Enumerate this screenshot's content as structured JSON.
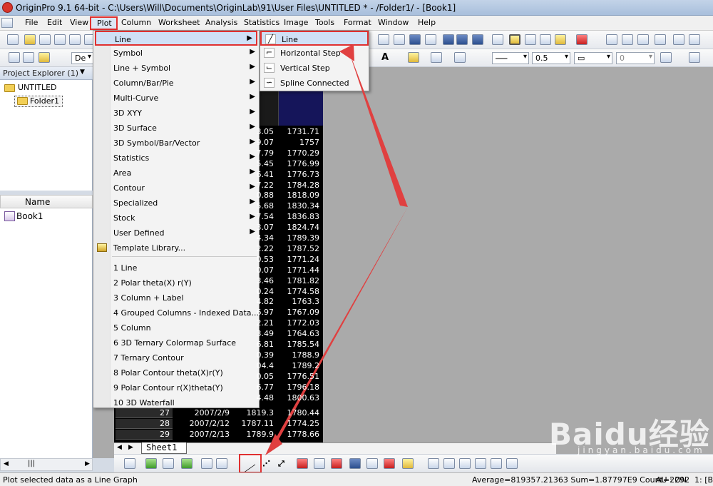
{
  "window": {
    "title": "OriginPro 9.1 64-bit - C:\\Users\\Will\\Documents\\OriginLab\\91\\User Files\\UNTITLED * - /Folder1/ - [Book1]"
  },
  "menubar": {
    "file": "File",
    "edit": "Edit",
    "view": "View",
    "plot": "Plot",
    "column": "Column",
    "worksheet": "Worksheet",
    "analysis": "Analysis",
    "statistics": "Statistics",
    "image": "Image",
    "tools": "Tools",
    "format": "Format",
    "window": "Window",
    "help": "Help"
  },
  "format_toolbar": {
    "line_width": "0.5",
    "value_zero": "0",
    "font_abbrev": "De"
  },
  "project_explorer": {
    "title": "Project Explorer (1)",
    "root": "UNTITLED",
    "folder": "Folder1",
    "list_header": "Name",
    "items": [
      "Book1"
    ]
  },
  "plot_menu": [
    {
      "label": "Line",
      "submenu": true
    },
    {
      "label": "Symbol",
      "submenu": true
    },
    {
      "label": "Line + Symbol",
      "submenu": true
    },
    {
      "label": "Column/Bar/Pie",
      "submenu": true
    },
    {
      "label": "Multi-Curve",
      "submenu": true
    },
    {
      "label": "3D XYY",
      "submenu": true
    },
    {
      "label": "3D Surface",
      "submenu": true
    },
    {
      "label": "3D Symbol/Bar/Vector",
      "submenu": true
    },
    {
      "label": "Statistics",
      "submenu": true
    },
    {
      "label": "Area",
      "submenu": true
    },
    {
      "label": "Contour",
      "submenu": true
    },
    {
      "label": "Specialized",
      "submenu": true
    },
    {
      "label": "Stock",
      "submenu": true
    },
    {
      "label": "User Defined",
      "submenu": true
    },
    {
      "label": "Template Library...",
      "submenu": false
    },
    {
      "label": "1 Line",
      "submenu": false
    },
    {
      "label": "2 Polar theta(X) r(Y)",
      "submenu": false
    },
    {
      "label": "3 Column + Label",
      "submenu": false
    },
    {
      "label": "4 Grouped Columns - Indexed Data...",
      "submenu": false
    },
    {
      "label": "5 Column",
      "submenu": false
    },
    {
      "label": "6 3D Ternary Colormap Surface",
      "submenu": false
    },
    {
      "label": "7 Ternary Contour",
      "submenu": false
    },
    {
      "label": "8 Polar Contour theta(X)r(Y)",
      "submenu": false
    },
    {
      "label": "9 Polar Contour r(X)theta(Y)",
      "submenu": false
    },
    {
      "label": "10 3D Waterfall",
      "submenu": false
    }
  ],
  "line_submenu": [
    "Line",
    "Horizontal Step",
    "Vertical Step",
    "Spline Connected"
  ],
  "worksheet": {
    "col_a_fragments": [
      "3.05",
      "9.07",
      "7.79",
      "5.45",
      "6.41",
      "7.22",
      "0.88",
      "5.68",
      "7.54",
      "3.07",
      "4.34",
      "2.22",
      "0.53",
      "0.07",
      "3.46",
      "0.24",
      "4.82",
      "6.97",
      "2.21",
      "3.49",
      "6.81",
      "0.39",
      "04.4",
      "0.05",
      "6.77",
      "4.48"
    ],
    "col_b": [
      "1731.71",
      "1757",
      "1770.29",
      "1776.99",
      "1776.73",
      "1784.28",
      "1818.09",
      "1830.34",
      "1836.83",
      "1824.74",
      "1789.39",
      "1787.52",
      "1771.24",
      "1771.44",
      "1781.82",
      "1774.58",
      "1763.3",
      "1767.09",
      "1772.03",
      "1764.63",
      "1785.54",
      "1788.9",
      "1789.2",
      "1776.51",
      "1796.18",
      "1800.63"
    ],
    "tail_rows": [
      {
        "n": "27",
        "date": "2007/2/9",
        "a": "1819.3",
        "b": "1780.44"
      },
      {
        "n": "28",
        "date": "2007/2/12",
        "a": "1787.11",
        "b": "1774.25"
      },
      {
        "n": "29",
        "date": "2007/2/13",
        "a": "1789.9",
        "b": "1778.66"
      }
    ],
    "sheet_tab": "Sheet1"
  },
  "statusbar": {
    "hint": "Plot selected data as a Line Graph",
    "stats": "Average=819357.21363 Sum=1.87797E9 Count=2292",
    "au": "AU : ON",
    "pos": "1: [B"
  },
  "watermark": {
    "logo": "Baidu经验",
    "sub": "jingyan.baidu.com"
  }
}
